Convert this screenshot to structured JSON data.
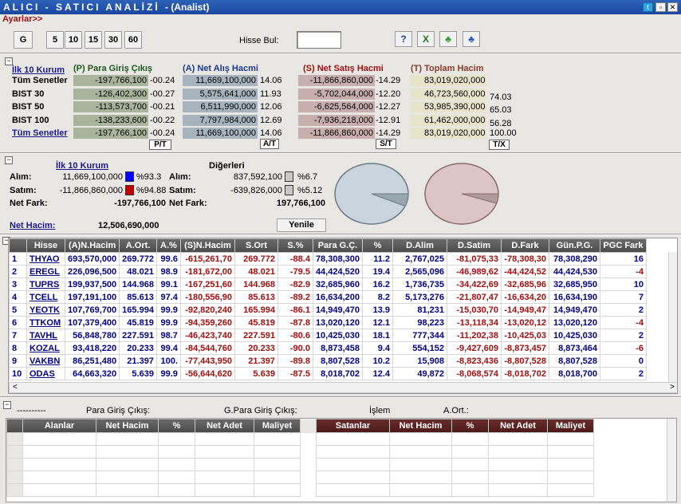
{
  "window": {
    "title": "ALICI - SATICI ANALİZİ",
    "subtitle": "- (Analist)"
  },
  "menu": {
    "label": "Ayarlar>>"
  },
  "toolbar": {
    "periods": [
      "G",
      "5",
      "10",
      "15",
      "30",
      "60"
    ],
    "search_label": "Hisse Bul:",
    "search_value": ""
  },
  "colors": {
    "pos": "#000080",
    "neg": "#a01010",
    "title": "#1a47a0"
  },
  "summary": {
    "headers": {
      "top10": "İlk 10 Kurum",
      "para": "(P) Para Giriş Çıkış",
      "alis": "(A) Net Alış Hacmi",
      "satis": "(S) Net Satış Hacmi",
      "toplam": "(T) Toplam Hacim"
    },
    "rows": [
      {
        "name": "Tüm Senetler",
        "p": "-197,766,100",
        "pp": "-00.24",
        "a": "11,669,100,000",
        "ap": "14.06",
        "s": "-11,866,860,000",
        "sp": "-14.29",
        "t": "83,019,020,000",
        "tp": ""
      },
      {
        "name": "BIST 30",
        "p": "-126,402,300",
        "pp": "-00.27",
        "a": "5,575,641,000",
        "ap": "11.93",
        "s": "-5,702,044,000",
        "sp": "-12.20",
        "t": "46,723,560,000",
        "tp": "74.03"
      },
      {
        "name": "BIST 50",
        "p": "-113,573,700",
        "pp": "-00.21",
        "a": "6,511,990,000",
        "ap": "12.06",
        "s": "-6,625,564,000",
        "sp": "-12.27",
        "t": "53,985,390,000",
        "tp": "65.03"
      },
      {
        "name": "BIST 100",
        "p": "-138,233,600",
        "pp": "-00.22",
        "a": "7,797,984,000",
        "ap": "12.69",
        "s": "-7,936,218,000",
        "sp": "-12.91",
        "t": "61,462,000,000",
        "tp": "56.28"
      },
      {
        "name": "Tüm Senetler",
        "p": "-197,766,100",
        "pp": "-00.24",
        "a": "11,669,100,000",
        "ap": "14.06",
        "s": "-11,866,860,000",
        "sp": "-14.29",
        "t": "83,019,020,000",
        "tp": "100.00"
      }
    ],
    "buttons": {
      "pt": "P/T",
      "at": "A/T",
      "st": "S/T",
      "tx": "T/X"
    }
  },
  "middle": {
    "top10_title": "İlk 10 Kurum",
    "others_title": "Diğerleri",
    "alim_label": "Alım:",
    "satim_label": "Satım:",
    "fark_label": "Net Fark:",
    "top10": {
      "alim": "11,669,100,000",
      "alim_pct": "%93.3",
      "satim": "-11,866,860,000",
      "satim_pct": "%94.88",
      "fark": "-197,766,100"
    },
    "others": {
      "alim": "837,592,100",
      "alim_pct": "%6.7",
      "satim": "-639,826,000",
      "satim_pct": "%5.12",
      "fark": "197,766,100"
    },
    "net_hacim_label": "Net Hacim:",
    "net_hacim": "12,506,690,000",
    "refresh": "Yenile",
    "pie_left_share": 0.067,
    "pie_right_share": 0.0512
  },
  "table": {
    "columns": [
      "",
      "Hisse",
      "(A)N.Hacim",
      "A.Ort.",
      "A.%",
      "(S)N.Hacim",
      "S.Ort",
      "S.%",
      "Para G.Ç.",
      "%",
      "D.Alim",
      "D.Satim",
      "D.Fark",
      "Gün.P.G.",
      "PGC Fark"
    ],
    "rows": [
      [
        "1",
        "THYAO",
        "693,570,000",
        "269.772",
        "99.6",
        "-615,261,70",
        "269.772",
        "-88.4",
        "78,308,300",
        "11.2",
        "2,767,025",
        "-81,075,33",
        "-78,308,30",
        "78,308,290",
        "16"
      ],
      [
        "2",
        "EREGL",
        "226,096,500",
        "48.021",
        "98.9",
        "-181,672,00",
        "48.021",
        "-79.5",
        "44,424,520",
        "19.4",
        "2,565,096",
        "-46,989,62",
        "-44,424,52",
        "44,424,530",
        "-4"
      ],
      [
        "3",
        "TUPRS",
        "199,937,500",
        "144.968",
        "99.1",
        "-167,251,60",
        "144.968",
        "-82.9",
        "32,685,960",
        "16.2",
        "1,736,735",
        "-34,422,69",
        "-32,685,96",
        "32,685,950",
        "10"
      ],
      [
        "4",
        "TCELL",
        "197,191,100",
        "85.613",
        "97.4",
        "-180,556,90",
        "85.613",
        "-89.2",
        "16,634,200",
        "8.2",
        "5,173,276",
        "-21,807,47",
        "-16,634,20",
        "16,634,190",
        "7"
      ],
      [
        "5",
        "YEOTK",
        "107,769,700",
        "165.994",
        "99.9",
        "-92,820,240",
        "165.994",
        "-86.1",
        "14,949,470",
        "13.9",
        "81,231",
        "-15,030,70",
        "-14,949,47",
        "14,949,470",
        "2"
      ],
      [
        "6",
        "TTKOM",
        "107,379,400",
        "45.819",
        "99.9",
        "-94,359,260",
        "45.819",
        "-87.8",
        "13,020,120",
        "12.1",
        "98,223",
        "-13,118,34",
        "-13,020,12",
        "13,020,120",
        "-4"
      ],
      [
        "7",
        "TAVHL",
        "56,848,780",
        "227.591",
        "98.7",
        "-46,423,740",
        "227.591",
        "-80.6",
        "10,425,030",
        "18.1",
        "777,344",
        "-11,202,38",
        "-10,425,03",
        "10,425,030",
        "2"
      ],
      [
        "8",
        "KOZAL",
        "93,418,220",
        "20.233",
        "99.4",
        "-84,544,760",
        "20.233",
        "-90.0",
        "8,873,458",
        "9.4",
        "554,152",
        "-9,427,609",
        "-8,873,457",
        "8,873,464",
        "-6"
      ],
      [
        "9",
        "VAKBN",
        "86,251,480",
        "21.397",
        "100.",
        "-77,443,950",
        "21.397",
        "-89.8",
        "8,807,528",
        "10.2",
        "15,908",
        "-8,823,436",
        "-8,807,528",
        "8,807,528",
        "0"
      ],
      [
        "10",
        "ODAS",
        "64,663,320",
        "5.639",
        "99.9",
        "-56,644,620",
        "5.639",
        "-87.5",
        "8,018,702",
        "12.4",
        "49,872",
        "-8,068,574",
        "-8,018,702",
        "8,018,700",
        "2"
      ]
    ]
  },
  "bottom": {
    "dashes": "----------",
    "para": "Para Giriş Çıkış:",
    "gpara": "G.Para Giriş Çıkış:",
    "islem": "İşlem",
    "aort": "A.Ort.:",
    "left_cols": [
      "Alanlar",
      "Net Hacim",
      "%",
      "Net Adet",
      "Maliyet"
    ],
    "right_cols": [
      "Satanlar",
      "Net Hacim",
      "%",
      "Net Adet",
      "Maliyet"
    ]
  }
}
